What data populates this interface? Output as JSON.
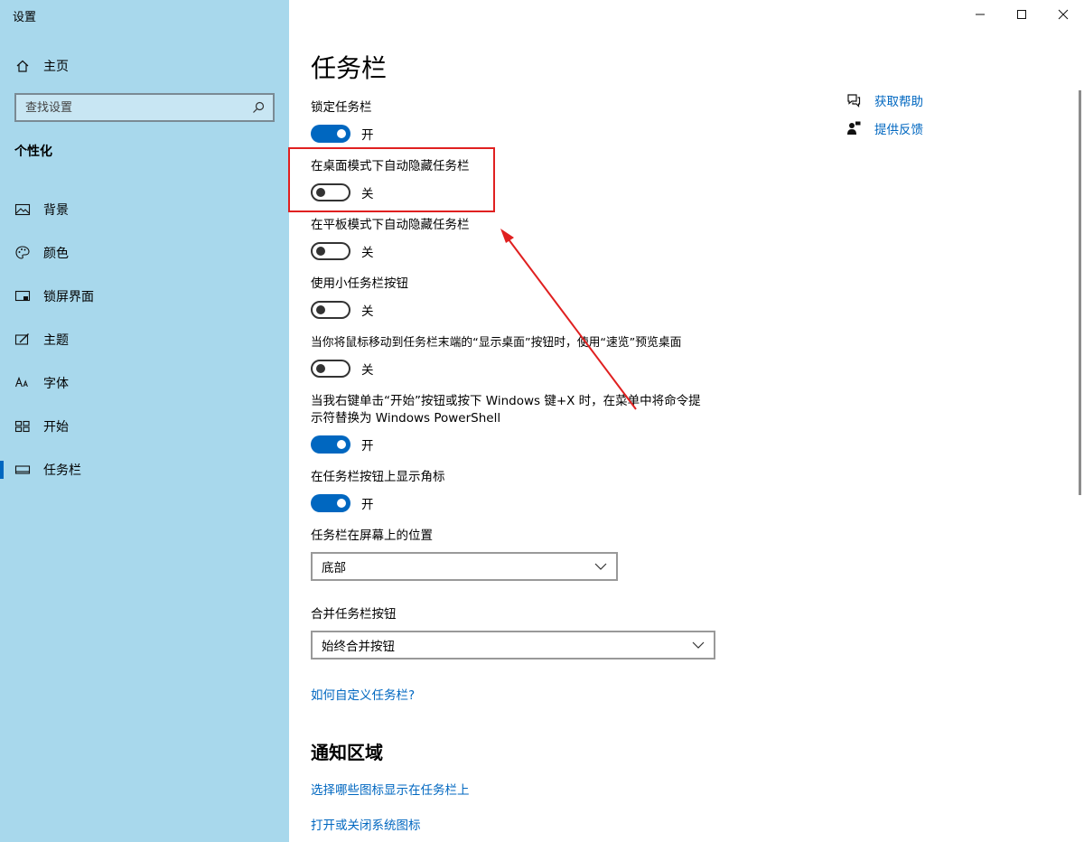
{
  "window": {
    "title": "设置",
    "controls": {
      "minimize": "minimize-icon",
      "maximize": "maximize-icon",
      "close": "close-icon"
    }
  },
  "sidebar": {
    "home_label": "主页",
    "search_placeholder": "查找设置",
    "section_title": "个性化",
    "items": [
      {
        "label": "背景",
        "icon": "image-icon"
      },
      {
        "label": "颜色",
        "icon": "palette-icon"
      },
      {
        "label": "锁屏界面",
        "icon": "lockscreen-icon"
      },
      {
        "label": "主题",
        "icon": "theme-icon"
      },
      {
        "label": "字体",
        "icon": "font-icon"
      },
      {
        "label": "开始",
        "icon": "start-icon"
      },
      {
        "label": "任务栏",
        "icon": "taskbar-icon",
        "active": true
      }
    ]
  },
  "main": {
    "title": "任务栏",
    "settings": [
      {
        "label": "锁定任务栏",
        "state": "开",
        "on": true
      },
      {
        "label": "在桌面模式下自动隐藏任务栏",
        "state": "关",
        "on": false
      },
      {
        "label": "在平板模式下自动隐藏任务栏",
        "state": "关",
        "on": false
      },
      {
        "label": "使用小任务栏按钮",
        "state": "关",
        "on": false
      },
      {
        "label": "当你将鼠标移动到任务栏末端的“显示桌面”按钮时，使用“速览”预览桌面",
        "state": "关",
        "on": false
      },
      {
        "label": "当我右键单击“开始”按钮或按下 Windows 键+X 时，在菜单中将命令提示符替换为 Windows PowerShell",
        "state": "开",
        "on": true
      },
      {
        "label": "在任务栏按钮上显示角标",
        "state": "开",
        "on": true
      }
    ],
    "position": {
      "label": "任务栏在屏幕上的位置",
      "value": "底部"
    },
    "combine": {
      "label": "合并任务栏按钮",
      "value": "始终合并按钮"
    },
    "customize_link": "如何自定义任务栏?",
    "notification_heading": "通知区域",
    "notification_links": [
      "选择哪些图标显示在任务栏上",
      "打开或关闭系统图标"
    ]
  },
  "help": {
    "get_help": "获取帮助",
    "feedback": "提供反馈"
  },
  "colors": {
    "accent": "#0067c0",
    "sidebar_bg": "#a8d8ec",
    "annotation": "#e02020"
  }
}
